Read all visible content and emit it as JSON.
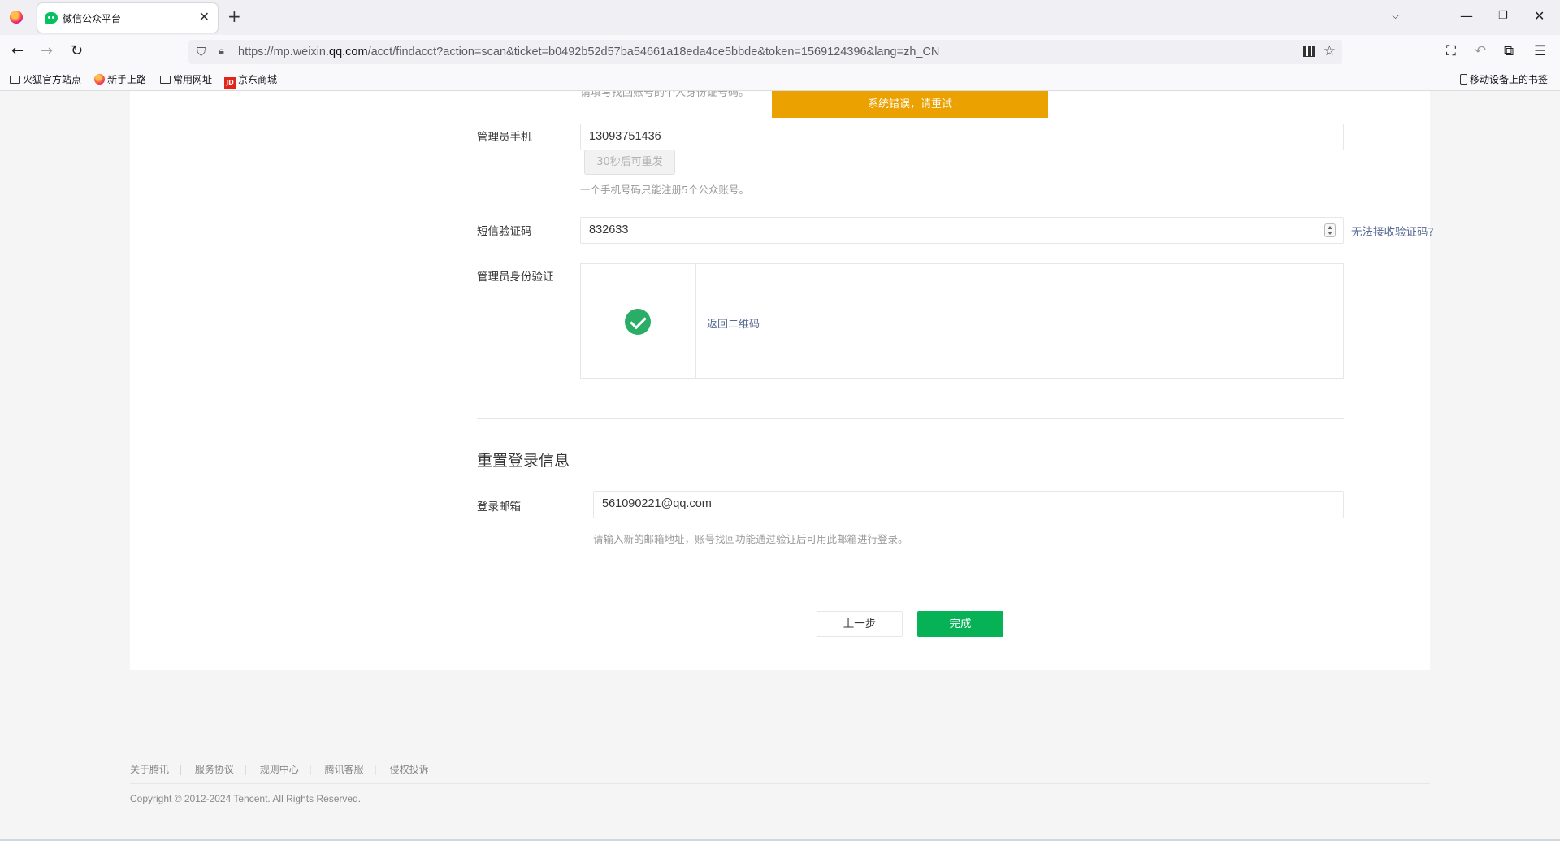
{
  "browser": {
    "tab_title": "微信公众平台",
    "url_prefix": "https://mp.weixin.",
    "url_domain": "qq.com",
    "url_rest": "/acct/findacct?action=scan&ticket=b0492b52d57ba54661a18eda4ce5bbde&token=1569124396&lang=zh_CN",
    "bookmarks": [
      "火狐官方站点",
      "新手上路",
      "常用网址",
      "京东商城"
    ],
    "mobile_bookmarks": "移动设备上的书签"
  },
  "form": {
    "hint_top": "请填写找回账号的个人身份证号码。",
    "toast": "系统错误，请重试",
    "phone_label": "管理员手机",
    "phone_value": "13093751436",
    "resend_label": "30秒后可重发",
    "phone_hint": "一个手机号码只能注册5个公众账号。",
    "sms_label": "短信验证码",
    "sms_value": "832633",
    "sms_help": "无法接收验证码?",
    "identity_label": "管理员身份验证",
    "back_qr": "返回二维码"
  },
  "reset": {
    "title": "重置登录信息",
    "email_label": "登录邮箱",
    "email_value": "561090221@qq.com",
    "email_hint": "请输入新的邮箱地址，账号找回功能通过验证后可用此邮箱进行登录。"
  },
  "actions": {
    "prev": "上一步",
    "done": "完成"
  },
  "footer": {
    "links": [
      "关于腾讯",
      "服务协议",
      "规则中心",
      "腾讯客服",
      "侵权投诉"
    ],
    "separator": "|",
    "copyright": "Copyright © 2012-2024 Tencent. All Rights Reserved."
  }
}
